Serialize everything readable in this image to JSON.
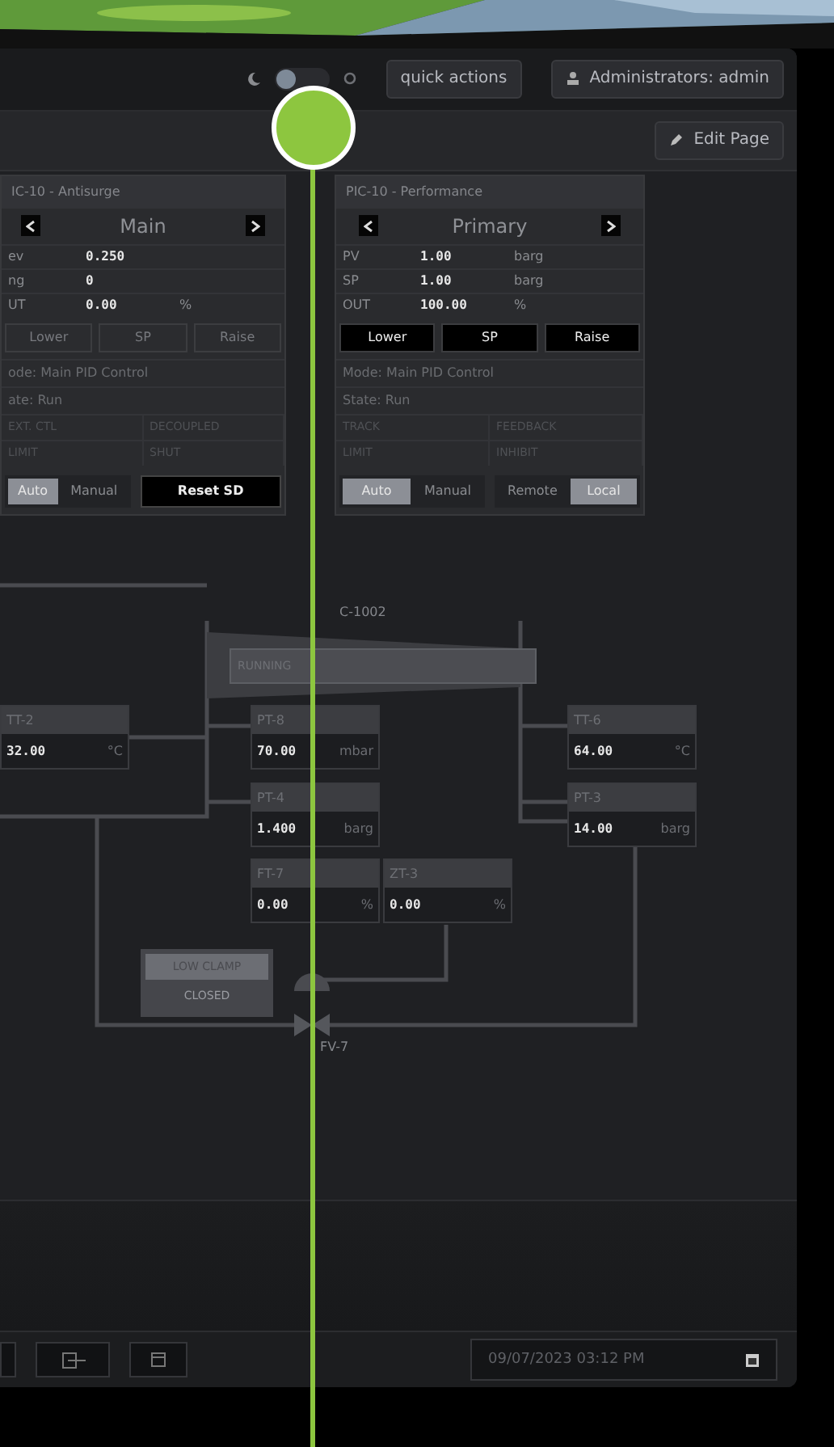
{
  "header": {
    "light_mode": false,
    "quick_actions": "quick actions",
    "user": "Administrators: admin"
  },
  "toolbar": {
    "edit": "Edit Page"
  },
  "faceplates": [
    {
      "title": "IC-10 - Antisurge",
      "page": "Main",
      "rows": [
        {
          "label": "ev",
          "value": "0.250",
          "unit": ""
        },
        {
          "label": "ng",
          "value": "0",
          "unit": ""
        },
        {
          "label": "UT",
          "value": "0.00",
          "unit": "%"
        }
      ],
      "buttons_enabled": false,
      "buttons": [
        "Lower",
        "SP",
        "Raise"
      ],
      "mode": "ode: Main PID Control",
      "state": "ate: Run",
      "grid": [
        "EXT. CTL",
        "DECOUPLED",
        "LIMIT",
        "SHUT"
      ],
      "bottom": [
        {
          "kind": "toggle",
          "options": [
            {
              "label": "Auto",
              "selected": true
            },
            {
              "label": "Manual",
              "selected": false
            }
          ]
        },
        {
          "kind": "button",
          "label": "Reset SD"
        }
      ]
    },
    {
      "title": "PIC-10 - Performance",
      "page": "Primary",
      "rows": [
        {
          "label": "PV",
          "value": "1.00",
          "unit": "barg"
        },
        {
          "label": "SP",
          "value": "1.00",
          "unit": "barg"
        },
        {
          "label": "OUT",
          "value": "100.00",
          "unit": "%"
        }
      ],
      "buttons_enabled": true,
      "buttons": [
        "Lower",
        "SP",
        "Raise"
      ],
      "mode": "Mode: Main PID Control",
      "state": "State: Run",
      "grid": [
        "TRACK",
        "FEEDBACK",
        "LIMIT",
        "INHIBIT"
      ],
      "bottom": [
        {
          "kind": "toggle",
          "options": [
            {
              "label": "Auto",
              "selected": true
            },
            {
              "label": "Manual",
              "selected": false
            }
          ]
        },
        {
          "kind": "toggle",
          "options": [
            {
              "label": "Remote",
              "selected": false
            },
            {
              "label": "Local",
              "selected": true
            }
          ]
        }
      ]
    }
  ],
  "diagram": {
    "unit": "C-1002",
    "status": "RUNNING",
    "tags": [
      {
        "tag": "TT-2",
        "value": "32.00",
        "unit": "°C"
      },
      {
        "tag": "PT-8",
        "value": "70.00",
        "unit": "mbar"
      },
      {
        "tag": "PT-4",
        "value": "1.400",
        "unit": "barg"
      },
      {
        "tag": "FT-7",
        "value": "0.00",
        "unit": "%"
      },
      {
        "tag": "ZT-3",
        "value": "0.00",
        "unit": "%"
      },
      {
        "tag": "TT-6",
        "value": "64.00",
        "unit": "°C"
      },
      {
        "tag": "PT-3",
        "value": "14.00",
        "unit": "barg"
      }
    ],
    "clamp": {
      "title": "LOW CLAMP",
      "state": "CLOSED"
    },
    "valve": "FV-7"
  },
  "footer": {
    "datetime": "09/07/2023 03:12 PM"
  }
}
